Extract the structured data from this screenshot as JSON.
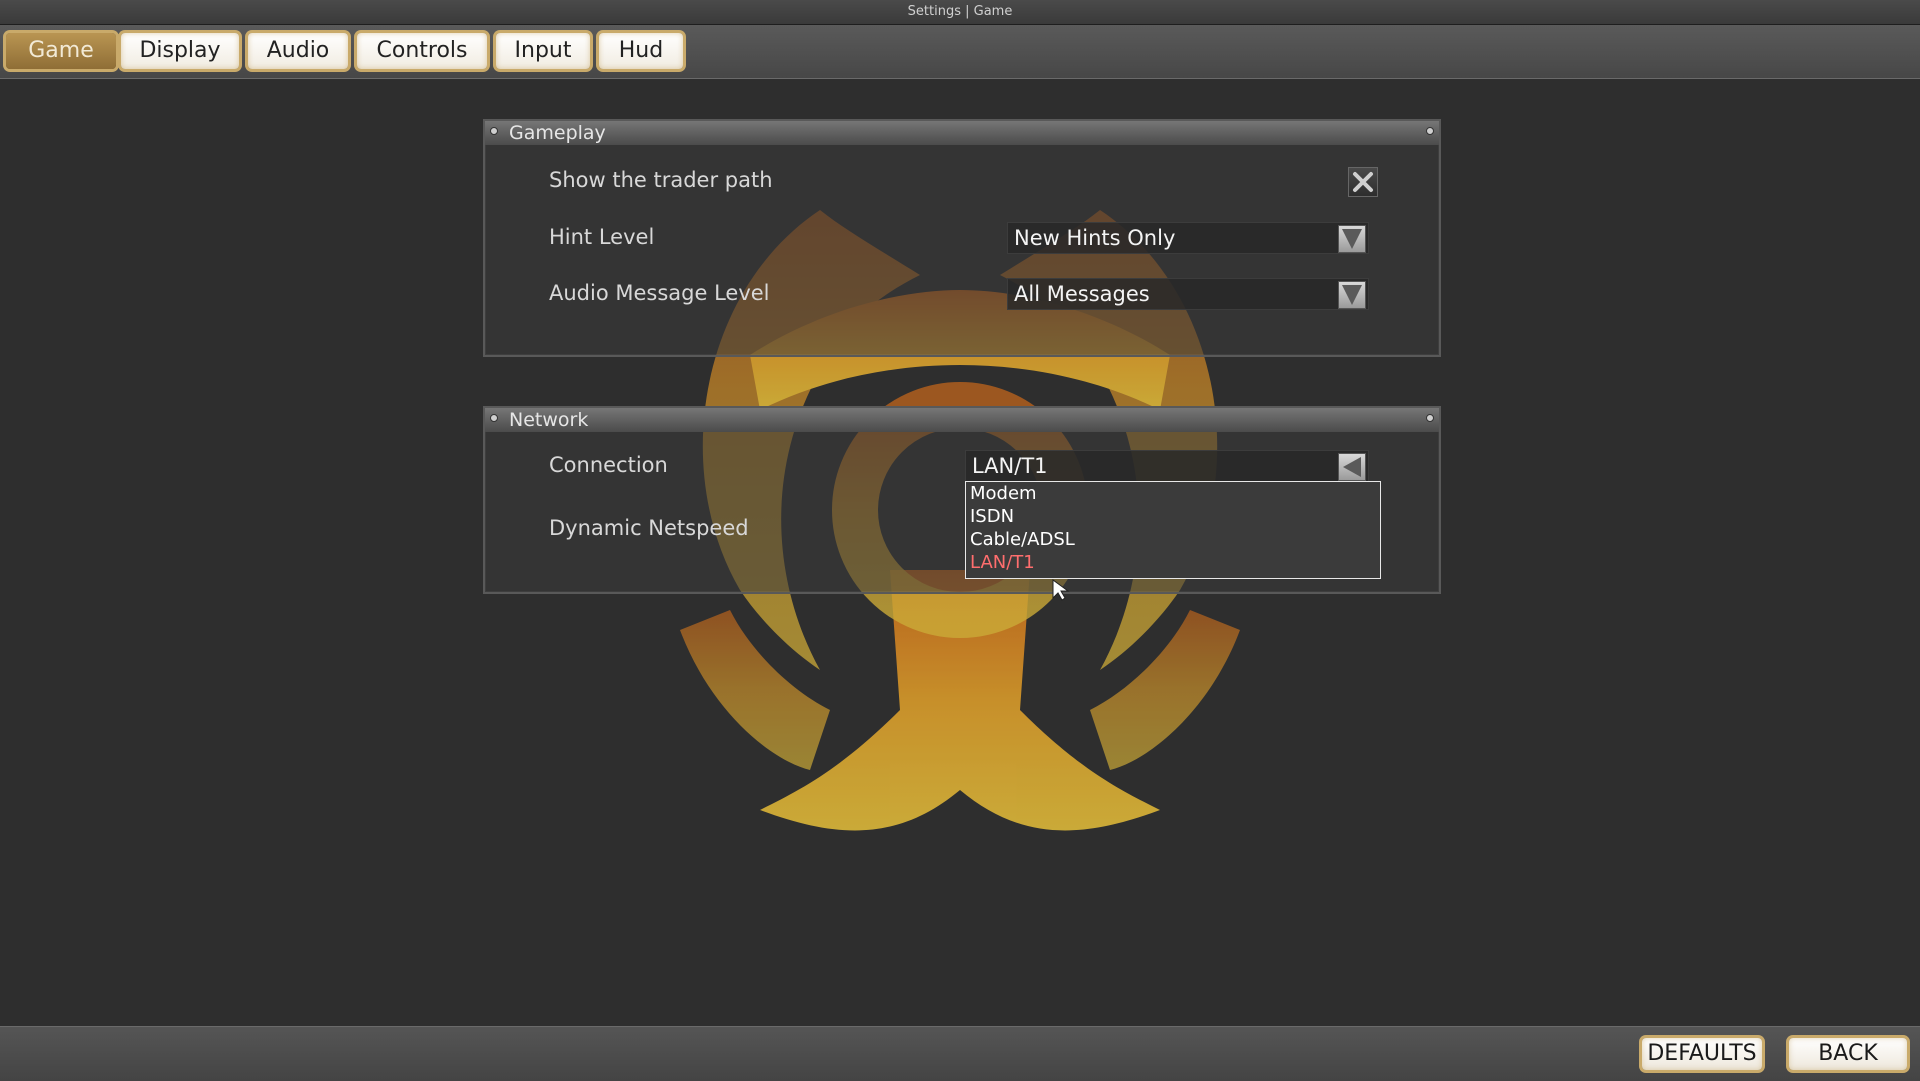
{
  "window": {
    "title": "Settings | Game"
  },
  "tabs": [
    {
      "label": "Game",
      "active": true
    },
    {
      "label": "Display",
      "active": false
    },
    {
      "label": "Audio",
      "active": false
    },
    {
      "label": "Controls",
      "active": false
    },
    {
      "label": "Input",
      "active": false
    },
    {
      "label": "Hud",
      "active": false
    }
  ],
  "gameplay": {
    "title": "Gameplay",
    "show_trader_path": {
      "label": "Show the trader path",
      "checked": true
    },
    "hint_level": {
      "label": "Hint Level",
      "value": "New Hints Only"
    },
    "audio_message_level": {
      "label": "Audio Message Level",
      "value": "All Messages"
    }
  },
  "network": {
    "title": "Network",
    "connection": {
      "label": "Connection",
      "value": "LAN/T1",
      "options": [
        "Modem",
        "ISDN",
        "Cable/ADSL",
        "LAN/T1"
      ],
      "selected_index": 3
    },
    "dynamic_netspeed": {
      "label": "Dynamic Netspeed"
    }
  },
  "footer": {
    "defaults_label": "DEFAULTS",
    "back_label": "BACK"
  },
  "colors": {
    "accent": "#c9aa6a",
    "selected_option": "#ff6e6e",
    "active_tab": "#a5833f"
  },
  "icons": {
    "decoration": "biohazard-icon",
    "checkbox_mark": "x-mark-icon",
    "combo_arrow": "triangle-down-icon"
  }
}
